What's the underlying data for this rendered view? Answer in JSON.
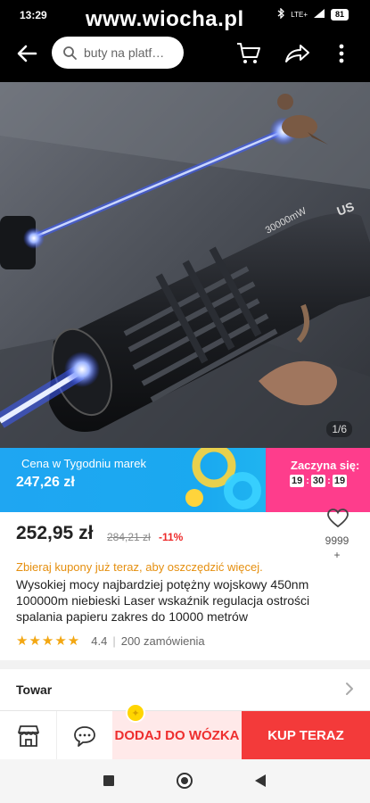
{
  "status_bar": {
    "time": "13:29",
    "network": "LTE+",
    "battery": "81"
  },
  "watermark": "www.wiocha.pl",
  "header": {
    "search_placeholder": "buty na platf…"
  },
  "gallery": {
    "pager": "1/6",
    "icons": [
      "arrow-left-icon",
      "cart-icon",
      "share-icon",
      "more-vertical-icon"
    ]
  },
  "promo": {
    "title": "Cena w Tygodniu marek",
    "price": "247,26 zł",
    "starts_label": "Zaczyna się:",
    "timer": [
      "19",
      "30",
      "19"
    ],
    "colors": {
      "left": "#1fa6f2",
      "right": "#fe3d8c"
    }
  },
  "product": {
    "price": "252,95 zł",
    "old_price": "284,21 zł",
    "discount": "-11%",
    "wishlist_count": "9999\n+",
    "coupon_text": "Zbieraj kupony już teraz, aby oszczędzić więcej.",
    "title": "Wysokiej mocy najbardziej potężny wojskowy 450nm 100000m niebieski Laser wskaźnik regulacja ostrości spalania papieru zakres do 10000 metrów",
    "rating_stars": "★★★★★",
    "rating_value": "4.4",
    "orders": "200 zamówienia"
  },
  "sections": {
    "towar": "Towar"
  },
  "actions": {
    "add_to_cart": "DODAJ DO WÓZKA",
    "buy_now": "KUP TERAZ",
    "colors": {
      "add_bg": "#ffe9e9",
      "add_text": "#ee2e2e",
      "buy_bg": "#f33a3a"
    }
  }
}
